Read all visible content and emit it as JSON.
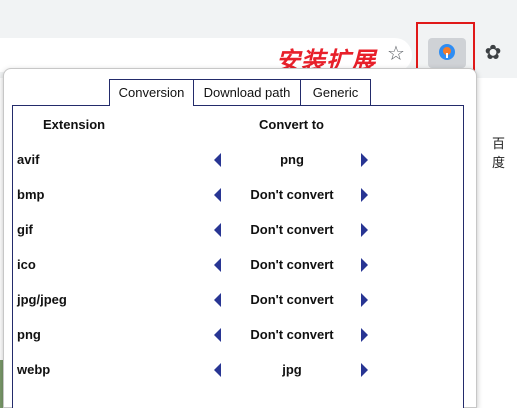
{
  "browser": {
    "annotation": "安装扩展",
    "page_side_text": "百度"
  },
  "popup": {
    "tabs": [
      {
        "label": "Conversion",
        "active": true
      },
      {
        "label": "Download path",
        "active": false
      },
      {
        "label": "Generic",
        "active": false
      }
    ],
    "headers": {
      "extension": "Extension",
      "convert_to": "Convert to"
    },
    "rows": [
      {
        "extension": "avif",
        "convert_to": "png"
      },
      {
        "extension": "bmp",
        "convert_to": "Don't convert"
      },
      {
        "extension": "gif",
        "convert_to": "Don't convert"
      },
      {
        "extension": "ico",
        "convert_to": "Don't convert"
      },
      {
        "extension": "jpg/jpeg",
        "convert_to": "Don't convert"
      },
      {
        "extension": "png",
        "convert_to": "Don't convert"
      },
      {
        "extension": "webp",
        "convert_to": "jpg"
      }
    ]
  },
  "colors": {
    "accent": "#283593",
    "annotation_red": "#e8202a",
    "highlight_border": "#e01818"
  },
  "icons": [
    "star-icon",
    "extension-logo-icon",
    "puzzle-icon",
    "arrow-left-icon",
    "arrow-right-icon"
  ]
}
